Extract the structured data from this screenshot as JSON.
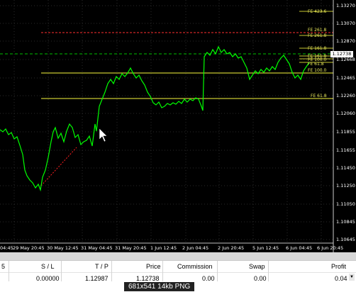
{
  "chart": {
    "background": "#000000",
    "price_line_color": "#00ff00",
    "fib_color": "#c8c832",
    "red_line_color": "#ff3030",
    "current_price": "1.12738",
    "price_axis": [
      "1.13270",
      "1.13070",
      "1.12870",
      "1.12668",
      "1.12465",
      "1.12260",
      "1.12060",
      "1.11855",
      "1.11655",
      "1.11450",
      "1.11250",
      "1.11050",
      "1.10845",
      "1.10645"
    ],
    "time_axis": [
      "04:45",
      "29 May 20:45",
      "30 May 12:45",
      "31 May 04:45",
      "31 May 20:45",
      "1 Jun 12:45",
      "2 Jun 04:45",
      "2 Jun 20:45",
      "5 Jun 12:45",
      "6 Jun 04:45",
      "6 Jun 20:45"
    ],
    "fib_labels": [
      "FE 423.6",
      "FE 261.8",
      "FE 261.8",
      "FE 161.8",
      "FE 161.8",
      "FE 100.0",
      "FE 61.8",
      "FE 100.0",
      "FE 61.8"
    ]
  },
  "terminal": {
    "columns": [
      "S / L",
      "T / P",
      "Price",
      "Commission",
      "Swap",
      "Profit"
    ],
    "left_fragment": "5",
    "row": {
      "sl": "0.00000",
      "tp": "1.12987",
      "price": "1.12738",
      "commission": "0.00",
      "swap": "0.00",
      "profit": "0.04"
    }
  },
  "caption": "681x541 14kb PNG"
}
